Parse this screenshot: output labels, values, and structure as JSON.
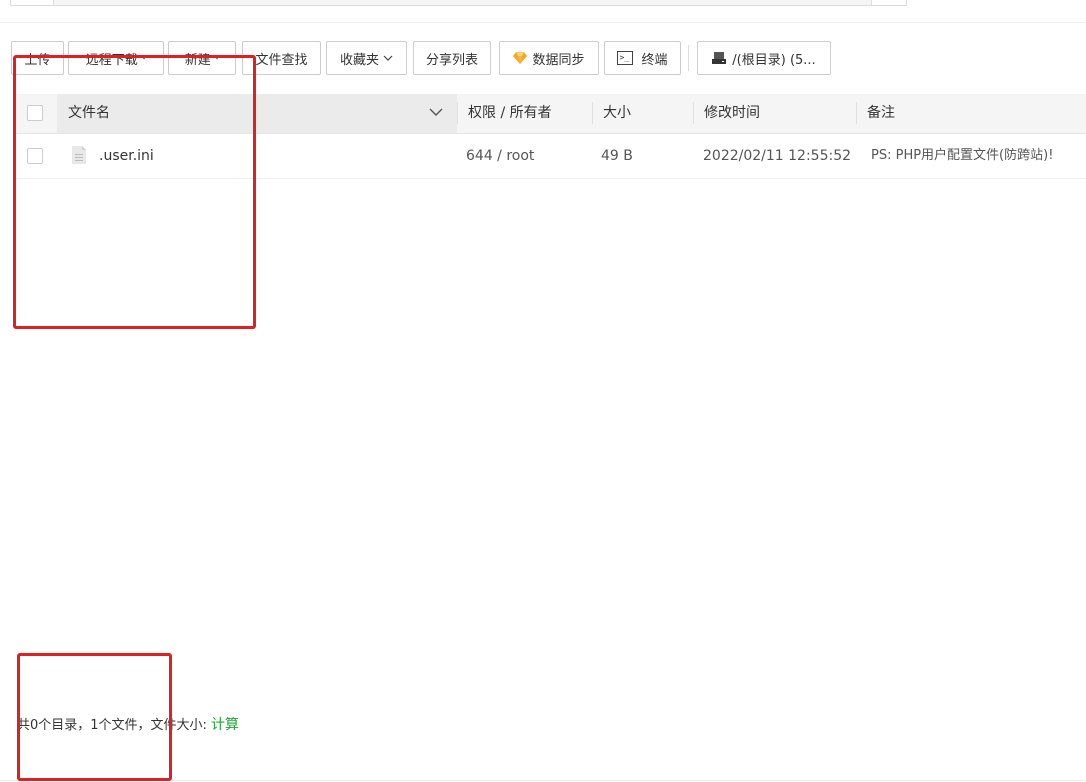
{
  "toolbar": {
    "upload": "上传",
    "remote_download": "远程下载",
    "new": "新建",
    "file_search": "文件查找",
    "favorites": "收藏夹",
    "share_list": "分享列表",
    "data_sync": "数据同步",
    "terminal": "终端",
    "disk": "/(根目录) (5..."
  },
  "table": {
    "headers": {
      "name": "文件名",
      "perm_owner": "权限 / 所有者",
      "size": "大小",
      "modified": "修改时间",
      "note": "备注"
    },
    "rows": [
      {
        "name": ".user.ini",
        "perm_owner": "644 / root",
        "size": "49 B",
        "modified": "2022/02/11 12:55:52",
        "note": "PS: PHP用户配置文件(防跨站)!"
      }
    ]
  },
  "footer": {
    "summary": "共0个目录，1个文件，文件大小:",
    "calculate": "计算"
  },
  "colors": {
    "accent_green": "#20a53a",
    "highlight_red": "#e02020",
    "gem_orange": "#f5a623"
  },
  "icons": {
    "data_sync": "gem-icon",
    "terminal": "terminal-icon",
    "disk": "disk-icon",
    "file": "file-icon",
    "sort": "chevron-down-icon"
  }
}
